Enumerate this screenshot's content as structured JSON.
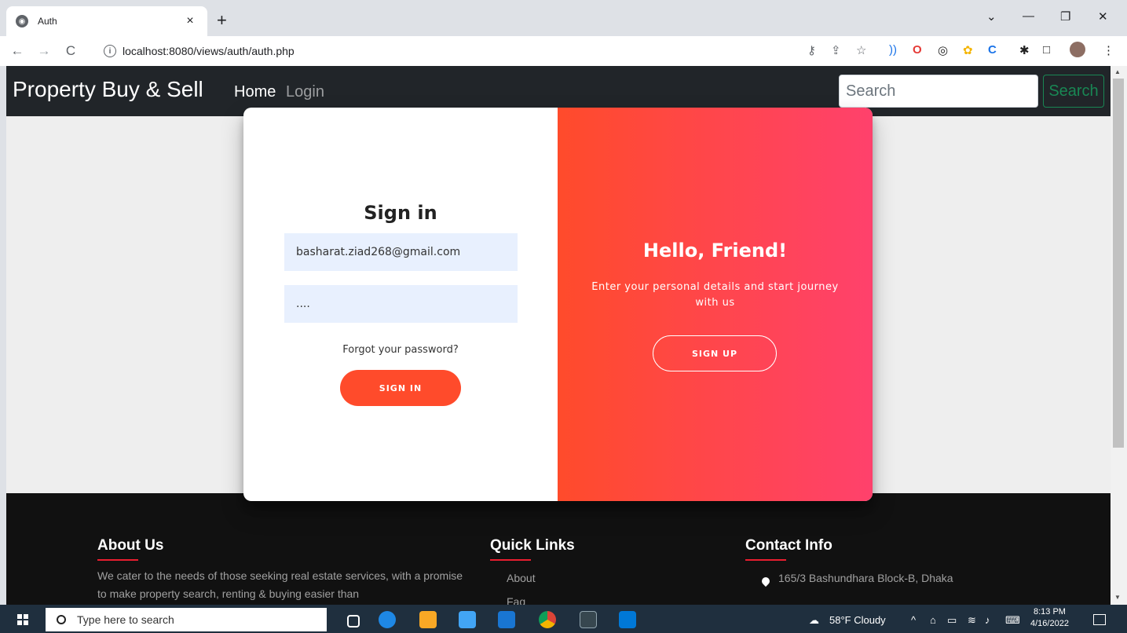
{
  "browser": {
    "tab_title": "Auth",
    "tab_close": "×",
    "new_tab": "+",
    "url": "localhost:8080/views/auth/auth.php",
    "back": "←",
    "forward": "→",
    "reload": "C"
  },
  "navbar": {
    "brand": "Property Buy & Sell",
    "home": "Home",
    "login": "Login",
    "search_placeholder": "Search",
    "search_button": "Search"
  },
  "signin": {
    "title": "Sign in",
    "email_value": "basharat.ziad268@gmail.com",
    "password_value": "....",
    "forgot": "Forgot your password?",
    "button": "SIGN IN"
  },
  "overlay": {
    "title": "Hello, Friend!",
    "text": "Enter your personal details and start journey with us",
    "button": "SIGN UP"
  },
  "footer": {
    "about_title": "About Us",
    "about_text": "We cater to the needs of those seeking real estate services, with a promise to make property search, renting & buying easier than",
    "links_title": "Quick Links",
    "links": [
      "About",
      "Faq"
    ],
    "contact_title": "Contact Info",
    "address": "165/3 Bashundhara Block-B, Dhaka"
  },
  "taskbar": {
    "search_placeholder": "Type here to search",
    "weather": "58°F  Cloudy",
    "time": "8:13 PM",
    "date": "4/16/2022"
  },
  "colors": {
    "accent_red": "#ff4b2b",
    "accent_pink": "#ff416c",
    "navbar_bg": "#212529",
    "footer_bg": "#111111",
    "search_green": "#198754"
  }
}
